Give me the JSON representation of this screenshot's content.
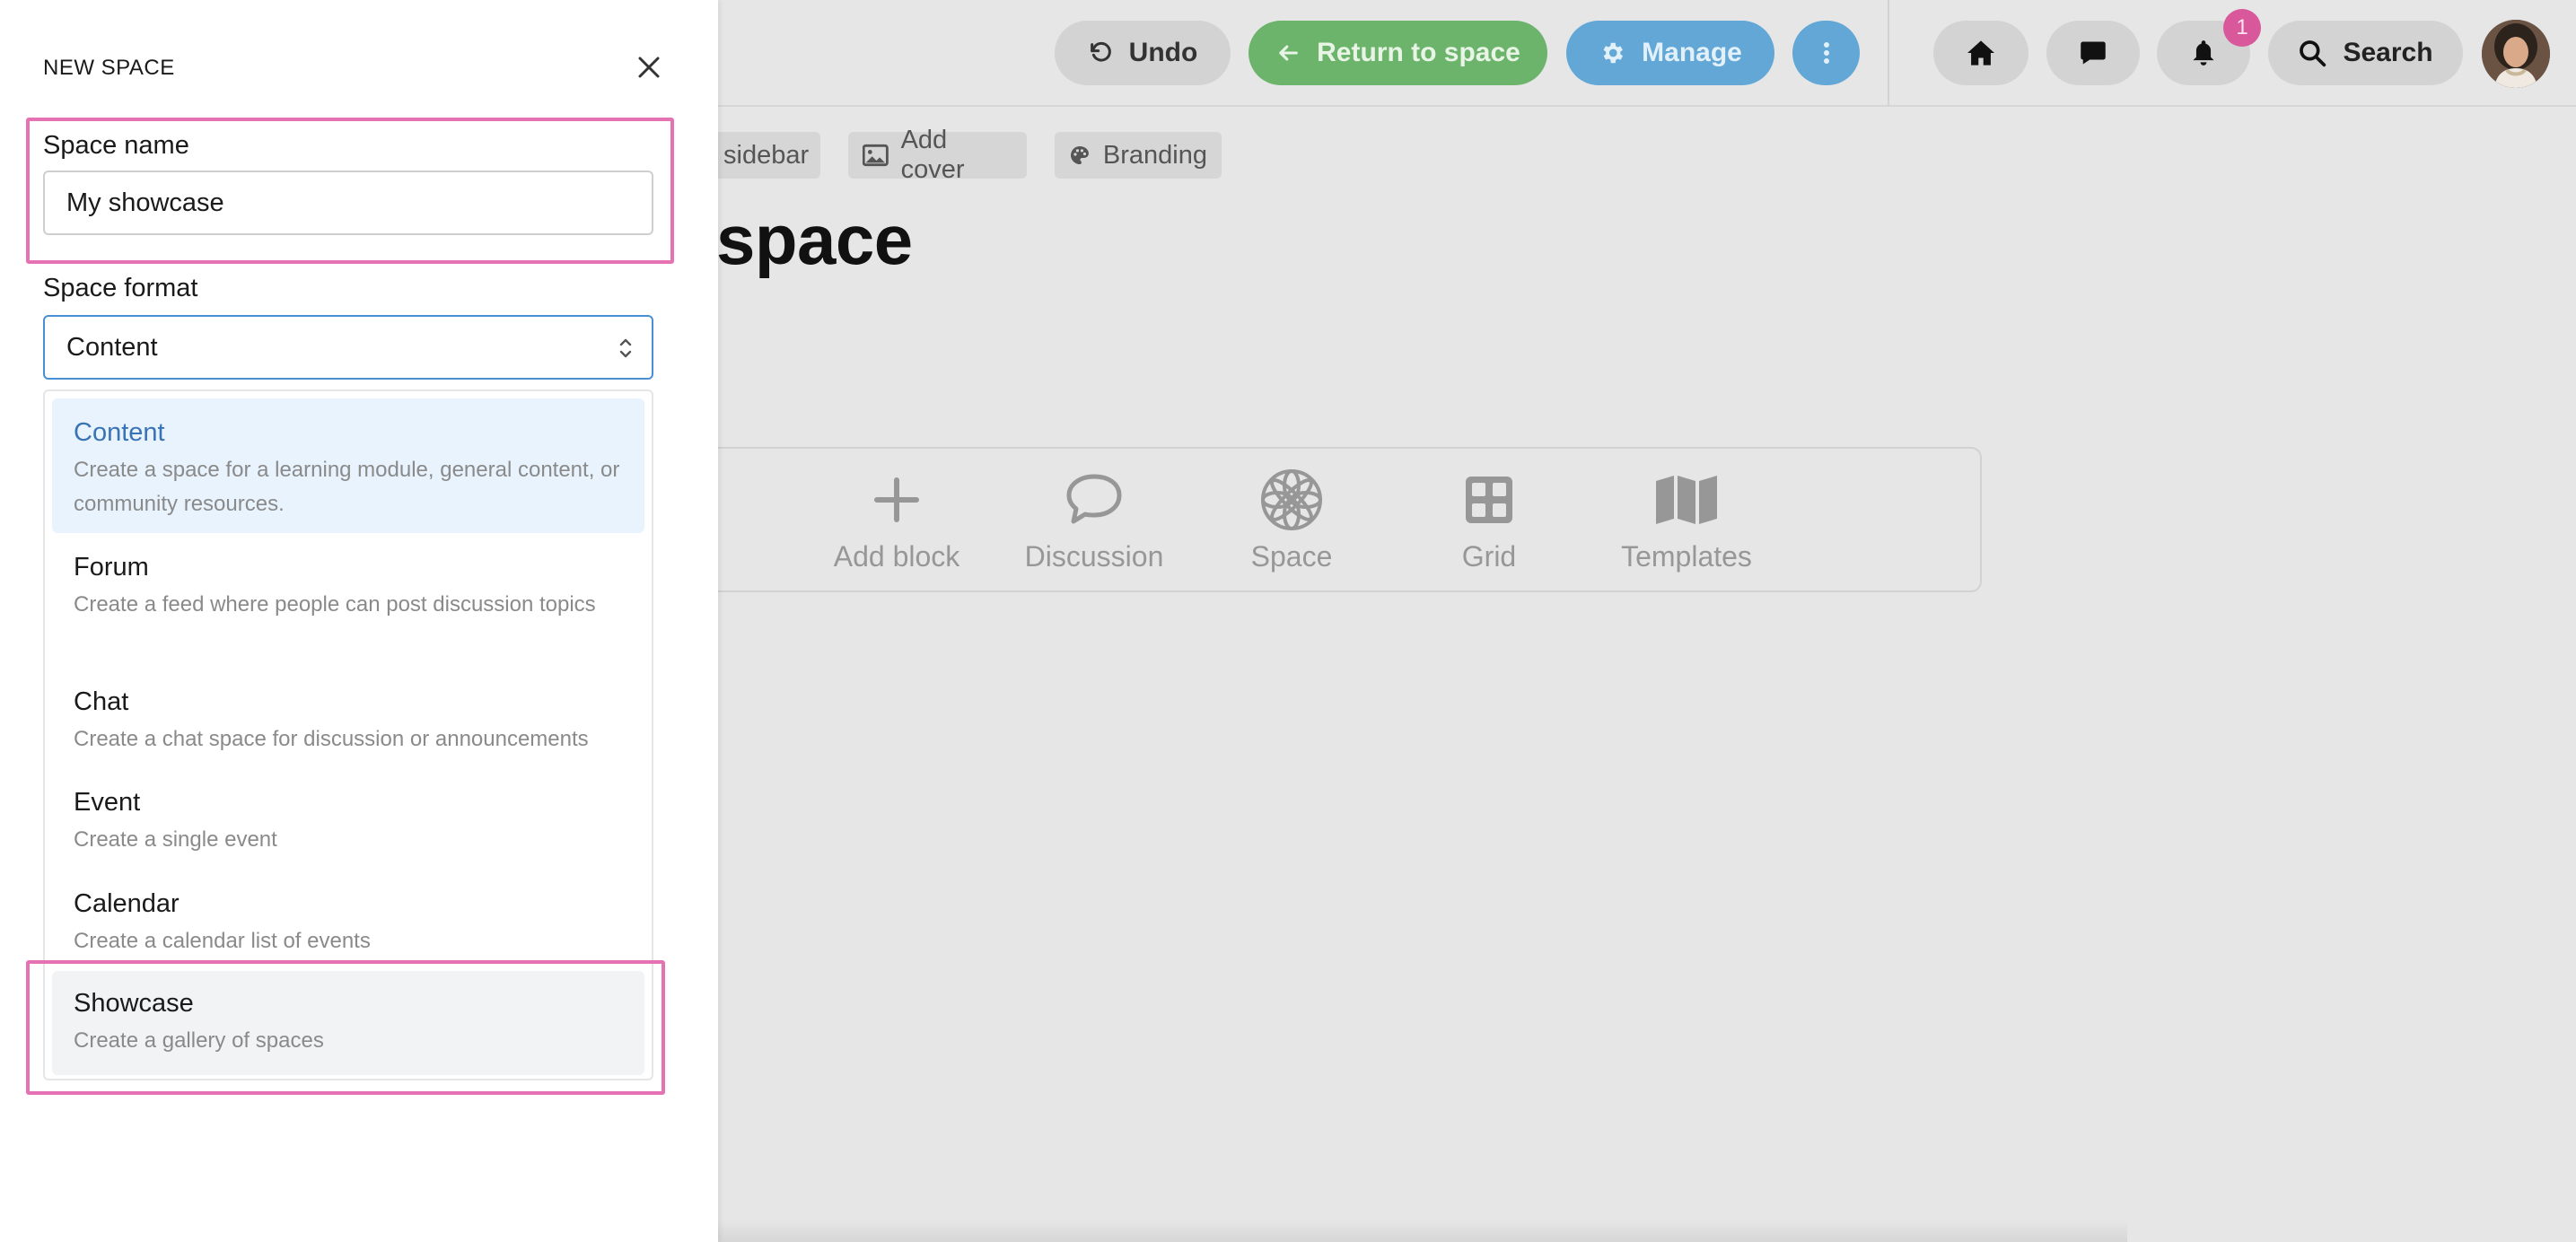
{
  "toolbar": {
    "undo_label": "Undo",
    "return_label": "Return to space",
    "manage_label": "Manage",
    "search_label": "Search",
    "notifications_count": "1"
  },
  "page": {
    "chips": {
      "sidebar_label": "sidebar",
      "cover_label": "Add cover",
      "branding_label": "Branding"
    },
    "heading": "space",
    "blocks": [
      {
        "label": "Add block",
        "icon": "plus-icon"
      },
      {
        "label": "Discussion",
        "icon": "speech-bubble-icon"
      },
      {
        "label": "Space",
        "icon": "flower-icon"
      },
      {
        "label": "Grid",
        "icon": "grid-icon"
      },
      {
        "label": "Templates",
        "icon": "map-icon"
      }
    ]
  },
  "drawer": {
    "title": "NEW SPACE",
    "space_name": {
      "label": "Space name",
      "value": "My showcase"
    },
    "space_format": {
      "label": "Space format",
      "selected": "Content",
      "options": [
        {
          "title": "Content",
          "description": "Create a space for a learning module, general content, or community resources."
        },
        {
          "title": "Forum",
          "description": "Create a feed where people can post discussion topics"
        },
        {
          "title": "Chat",
          "description": "Create a chat space for discussion or announcements"
        },
        {
          "title": "Event",
          "description": "Create a single event"
        },
        {
          "title": "Calendar",
          "description": "Create a calendar list of events"
        },
        {
          "title": "Showcase",
          "description": "Create a gallery of spaces"
        }
      ]
    }
  },
  "colors": {
    "highlight": "#e573b4",
    "return_button": "#6cb46b",
    "manage_button": "#62a7d6",
    "selected_option_bg": "#e8f3fd",
    "selected_option_text": "#3a73b5",
    "badge": "#d9579b"
  }
}
